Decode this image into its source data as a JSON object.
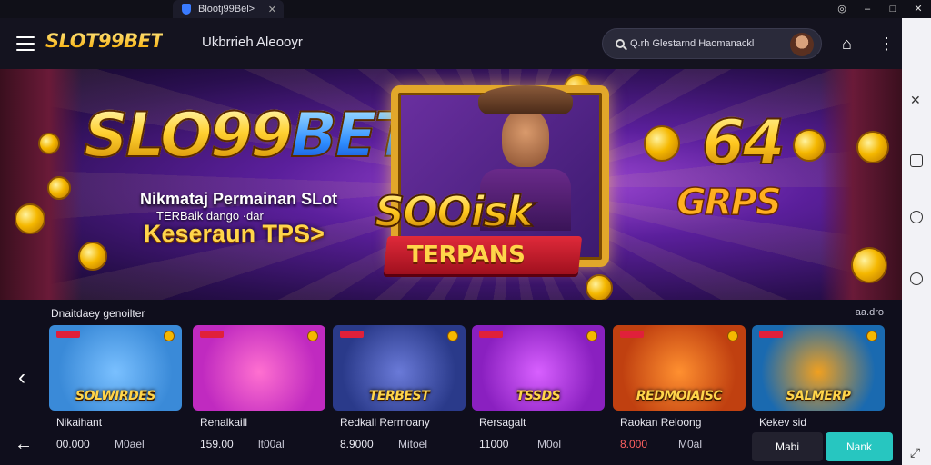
{
  "browser": {
    "tab_title": "Blootj99Bel>",
    "controls": [
      "◎",
      "–",
      "□",
      "✕"
    ]
  },
  "header": {
    "logo": "SLOT99BET",
    "nav_link": "Ukbrrieh Aleooyr",
    "search_text": "Q.rh Glestarnd Haomanackl"
  },
  "hero": {
    "title_gold": "SLO99",
    "title_blue": "BET",
    "tagline1": "Nikmataj Permainan SLot",
    "tagline2": "TERBaik dango   ·dar",
    "tagline3": "Keseraun TPS>",
    "promo_text": "SOOisk",
    "ribbon_text": "TERPANS",
    "big_number": "64",
    "side_text": "GRPS"
  },
  "games_section": {
    "title": "Dnaitdaey genoilter",
    "more": "aa.dro",
    "games": [
      {
        "card_label": "SOLWIRDES",
        "name": "Nikaihant",
        "amount": "00.000",
        "unit": "M0ael",
        "colors": [
          "#3a8ad8",
          "#7ac0ff"
        ]
      },
      {
        "card_label": "",
        "name": "Renalkaill",
        "amount": "159.00",
        "unit": "lt00al",
        "colors": [
          "#c02ac0",
          "#ff70d0"
        ]
      },
      {
        "card_label": "TERBEST",
        "name": "Redkall Rermoany",
        "amount": "8.9000",
        "unit": "Mitoel",
        "colors": [
          "#2a3a8a",
          "#6a7ad8"
        ]
      },
      {
        "card_label": "TSSDS",
        "name": "Rersagalt",
        "amount": "11000",
        "unit": "M0ol",
        "colors": [
          "#8a20c0",
          "#d860ff"
        ]
      },
      {
        "card_label": "REDMOIAISC",
        "name": "Raokan Reloong",
        "amount": "8.000",
        "unit": "M0al",
        "colors": [
          "#c04010",
          "#ff9030"
        ],
        "amount_red": true
      },
      {
        "card_label": "SALMERP",
        "name": "Kekev sid",
        "amount": "",
        "unit": "",
        "colors": [
          "#1a6ab0",
          "#f0a020"
        ]
      }
    ],
    "btn_dark": "Mabi",
    "btn_cyan": "Nank"
  }
}
